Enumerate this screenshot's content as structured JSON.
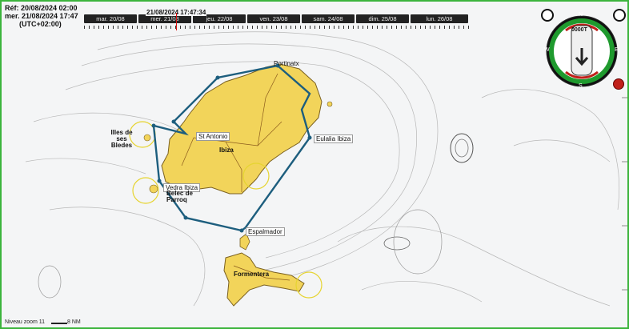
{
  "info": {
    "ref": "Réf: 20/08/2024 02:00",
    "date": "mer. 21/08/2024 17:47",
    "tz": "(UTC+02:00)"
  },
  "timeline": {
    "current": "21/08/2024 17:47:34",
    "days": [
      "mar. 20/08",
      "mer. 21/08",
      "jeu. 22/08",
      "ven. 23/08",
      "sam. 24/08",
      "dim. 25/08",
      "lun. 26/08"
    ]
  },
  "places": {
    "sant_antoni": "St Antonio",
    "santa_eulalia": "Eulalia Ibiza",
    "vedra": "Vedra Ibiza",
    "espalmador": "Espalmador",
    "formentera": "Formentera",
    "ibiza": "Ibiza",
    "ses_bledes": "Illes de ses Bledes",
    "portinatx": "Portinatx",
    "cala_d_hort": "Belec de Parroq"
  },
  "compass": {
    "speed": "0000T",
    "marks": [
      "N",
      "E",
      "S",
      "W"
    ]
  },
  "footer": {
    "zoom": "Niveau zoom 11",
    "scale": "8 NM"
  },
  "colors": {
    "land": "#f2d45a",
    "route": "#1d5e7e",
    "compass_ring": "#1f9a2e",
    "alarm": "#c0201a"
  }
}
